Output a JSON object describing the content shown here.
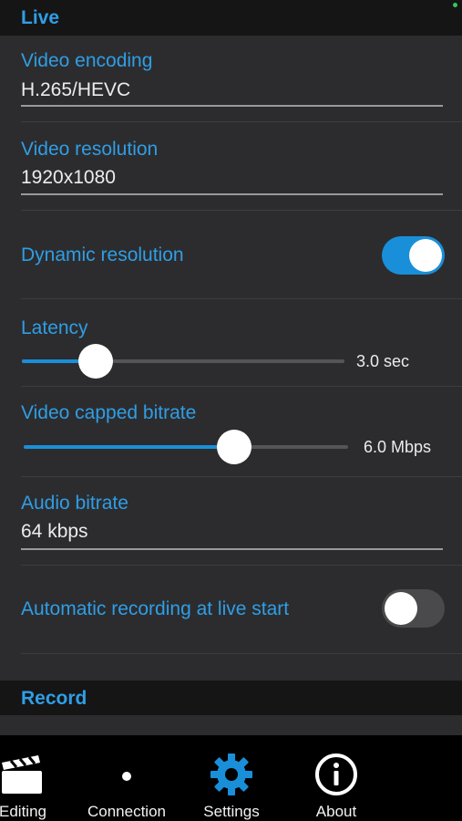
{
  "header": {
    "live_title": "Live"
  },
  "settings": {
    "video_encoding": {
      "label": "Video encoding",
      "value": "H.265/HEVC"
    },
    "video_resolution": {
      "label": "Video resolution",
      "value": "1920x1080"
    },
    "dynamic_resolution": {
      "label": "Dynamic resolution",
      "enabled": true
    },
    "latency": {
      "label": "Latency",
      "value_text": "3.0 sec",
      "fraction": 0.23
    },
    "video_capped_bitrate": {
      "label": "Video capped bitrate",
      "value_text": "6.0 Mbps",
      "fraction": 0.65
    },
    "audio_bitrate": {
      "label": "Audio bitrate",
      "value": "64 kbps"
    },
    "automatic_recording": {
      "label": "Automatic recording at live start",
      "enabled": false
    }
  },
  "record_section": {
    "title": "Record"
  },
  "tabbar": {
    "tabs": [
      {
        "label": "Editing",
        "icon": "clapperboard-icon",
        "active": false
      },
      {
        "label": "Connection",
        "icon": "dot-icon",
        "active": false
      },
      {
        "label": "Settings",
        "icon": "gear-icon",
        "active": true
      },
      {
        "label": "About",
        "icon": "info-icon",
        "active": false
      }
    ]
  },
  "colors": {
    "accent": "#1a8fd9",
    "label_blue": "#2f9ee6",
    "background": "#2c2c2e",
    "header_bg": "#151515",
    "tabbar_bg": "#000000"
  }
}
